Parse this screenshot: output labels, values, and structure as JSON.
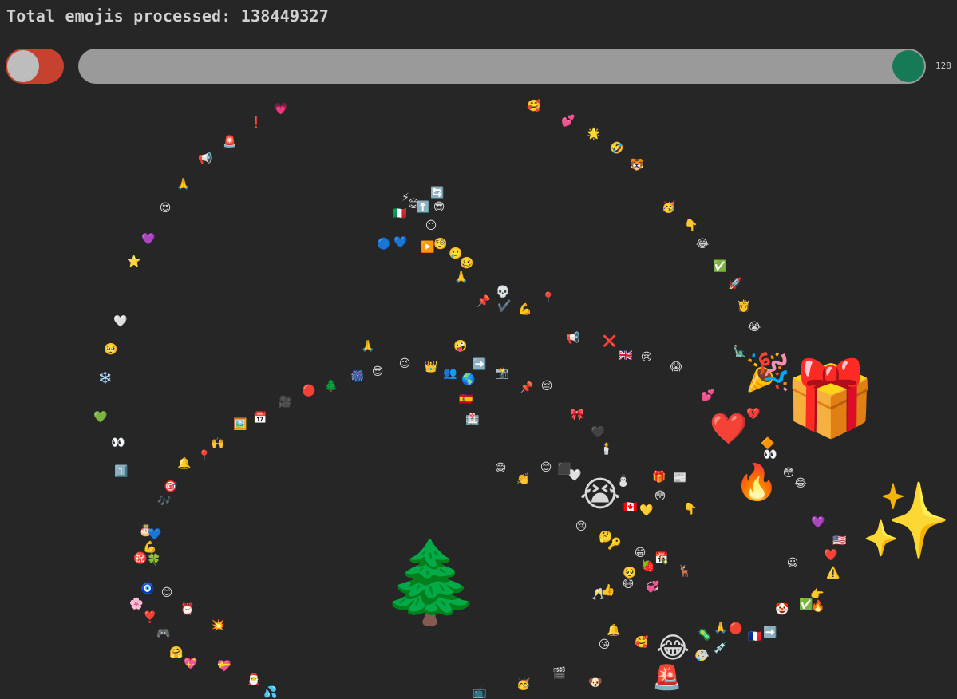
{
  "header": {
    "label": "Total emojis processed: 138449327"
  },
  "controls": {
    "toggle_on": true,
    "toggle_track_color": "#c6422e",
    "toggle_knob_color": "#bdbdbd",
    "slider_value": "128",
    "slider_fraction": 1.0,
    "slider_track_color": "#9a9a9a",
    "slider_thumb_color": "#157a55"
  },
  "emojis": [
    "🎁",
    "✨",
    "🌲",
    "😭",
    "🔥",
    "❤️",
    "🎉",
    "😂",
    "🚨",
    "💗",
    "❗",
    "🚨",
    "📢",
    "🙏",
    "😍",
    "💜",
    "⭐",
    "🤍",
    "🥺",
    "❄️",
    "💚",
    "👀",
    "1️⃣",
    "🎯",
    "🎶",
    "🎂",
    "💙",
    "💪",
    "㊗️",
    "🍀",
    "🧿",
    "😊",
    "🌸",
    "⏰",
    "❣️",
    "🎮",
    "💥",
    "🤗",
    "💝",
    "💖",
    "🎅",
    "💦",
    "🥰",
    "💕",
    "🌟",
    "🤣",
    "🐯",
    "🥳",
    "👇",
    "😂",
    "✅",
    "🚀",
    "👸",
    "😭",
    "🗽",
    "💔",
    "🔶",
    "👀",
    "😳",
    "😂",
    "💜",
    "🇺🇸",
    "❤️",
    "⚠️",
    "👉",
    "🔥",
    "✅",
    "🤡",
    "🔴",
    "➡️",
    "🙏",
    "🦠",
    "🤣",
    "💉",
    "😂",
    "🥰",
    "🚨",
    "🇮🇹",
    "⚡",
    "😊",
    "⬆️",
    "🔄",
    "😎",
    "😶",
    "🔵",
    "💙",
    "▶️",
    "🧐",
    "🥲",
    "🥴",
    "🙏",
    "💀",
    "📌",
    "✔️",
    "💪",
    "📍",
    "😱",
    "🙏",
    "🎆",
    "😎",
    "😉",
    "👑",
    "👥",
    "➡️",
    "📸",
    "🌎",
    "🇪🇸",
    "📌",
    "😔",
    "🏥",
    "🎀",
    "🖤",
    "🕯️",
    "📢",
    "❌",
    "🇬🇧",
    "😢",
    "🤪",
    "🎥",
    "🔴",
    "🌲",
    "🖼️",
    "📅",
    "🙌",
    "📍",
    "🔔",
    "👏",
    "😊",
    "😁",
    "🎁",
    "🤍",
    "⬛",
    "⛄",
    "🇨🇦",
    "😳",
    "📰",
    "💛",
    "🥺",
    "😢",
    "🦌",
    "🍓",
    "📅",
    "🥂",
    "👍",
    "😷",
    "💞",
    "🔔",
    "😘",
    "👇",
    "🍾",
    "🎬",
    "🐶",
    "📺",
    "🥳",
    "💕",
    "🇫🇷",
    "😂",
    "🔑",
    "😁",
    "🤔",
    "😀"
  ]
}
